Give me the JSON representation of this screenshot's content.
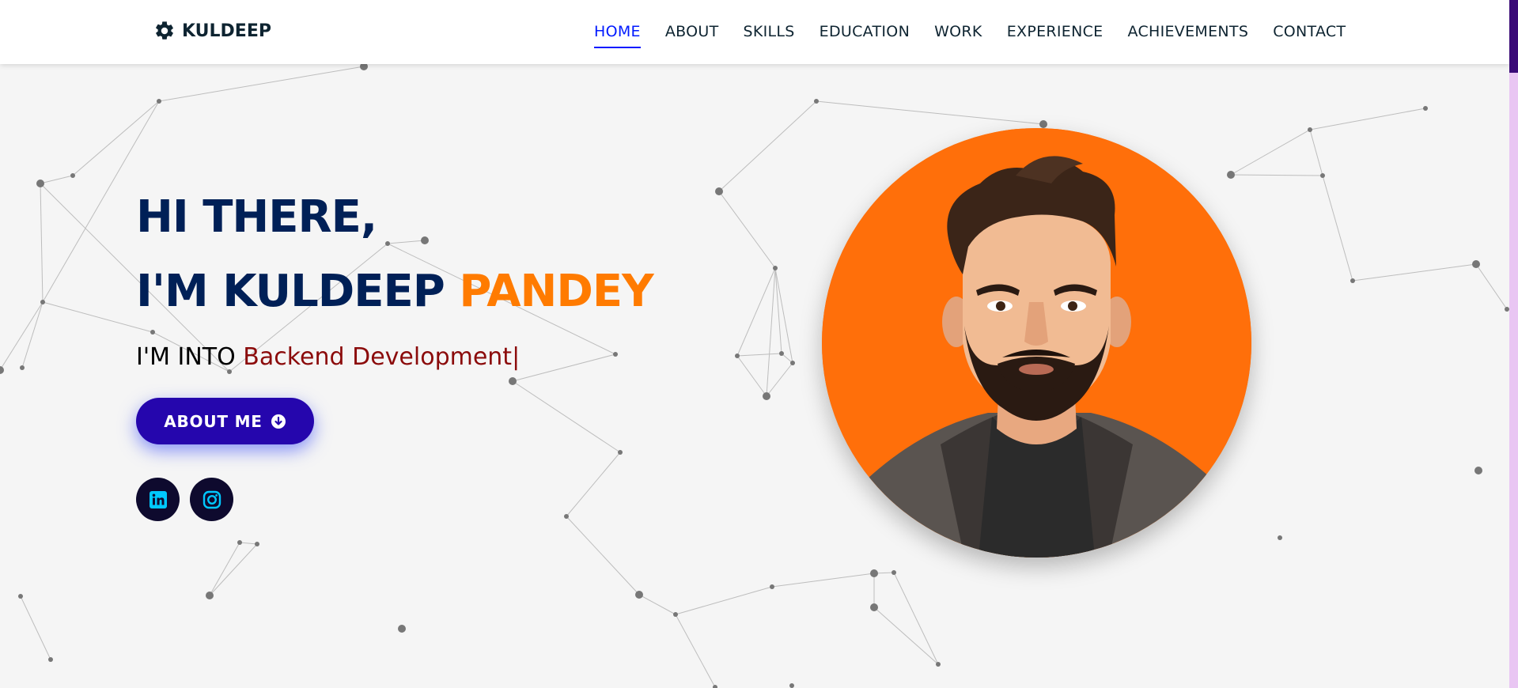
{
  "navbar": {
    "brand_icon": "gear-icon",
    "brand": "KULDEEP",
    "items": [
      {
        "label": "HOME",
        "active": true
      },
      {
        "label": "ABOUT",
        "active": false
      },
      {
        "label": "SKILLS",
        "active": false
      },
      {
        "label": "EDUCATION",
        "active": false
      },
      {
        "label": "WORK",
        "active": false
      },
      {
        "label": "EXPERIENCE",
        "active": false
      },
      {
        "label": "ACHIEVEMENTS",
        "active": false
      },
      {
        "label": "CONTACT",
        "active": false
      }
    ],
    "active_color": "#011aff"
  },
  "hero": {
    "greeting": "HI THERE,",
    "intro": "I'M KULDEEP",
    "name_highlight": "PANDEY",
    "sub_prefix": "I'M INTO",
    "sub_typed": "Backend Development",
    "cursor": "|",
    "button_label": "ABOUT ME",
    "button_icon": "arrow-down-circle-icon",
    "socials": [
      {
        "name": "linkedin",
        "icon": "linkedin-icon"
      },
      {
        "name": "instagram",
        "icon": "instagram-icon"
      }
    ]
  },
  "avatar": {
    "description": "avatar-illustration",
    "bg_color": "#ff6f0a"
  },
  "colors": {
    "heading": "#002057",
    "accent": "#ff7b00",
    "typed": "#8b0b0b",
    "button": "#2506ad",
    "social_bg": "#0e0a2e",
    "social_icon": "#00c8ff"
  }
}
